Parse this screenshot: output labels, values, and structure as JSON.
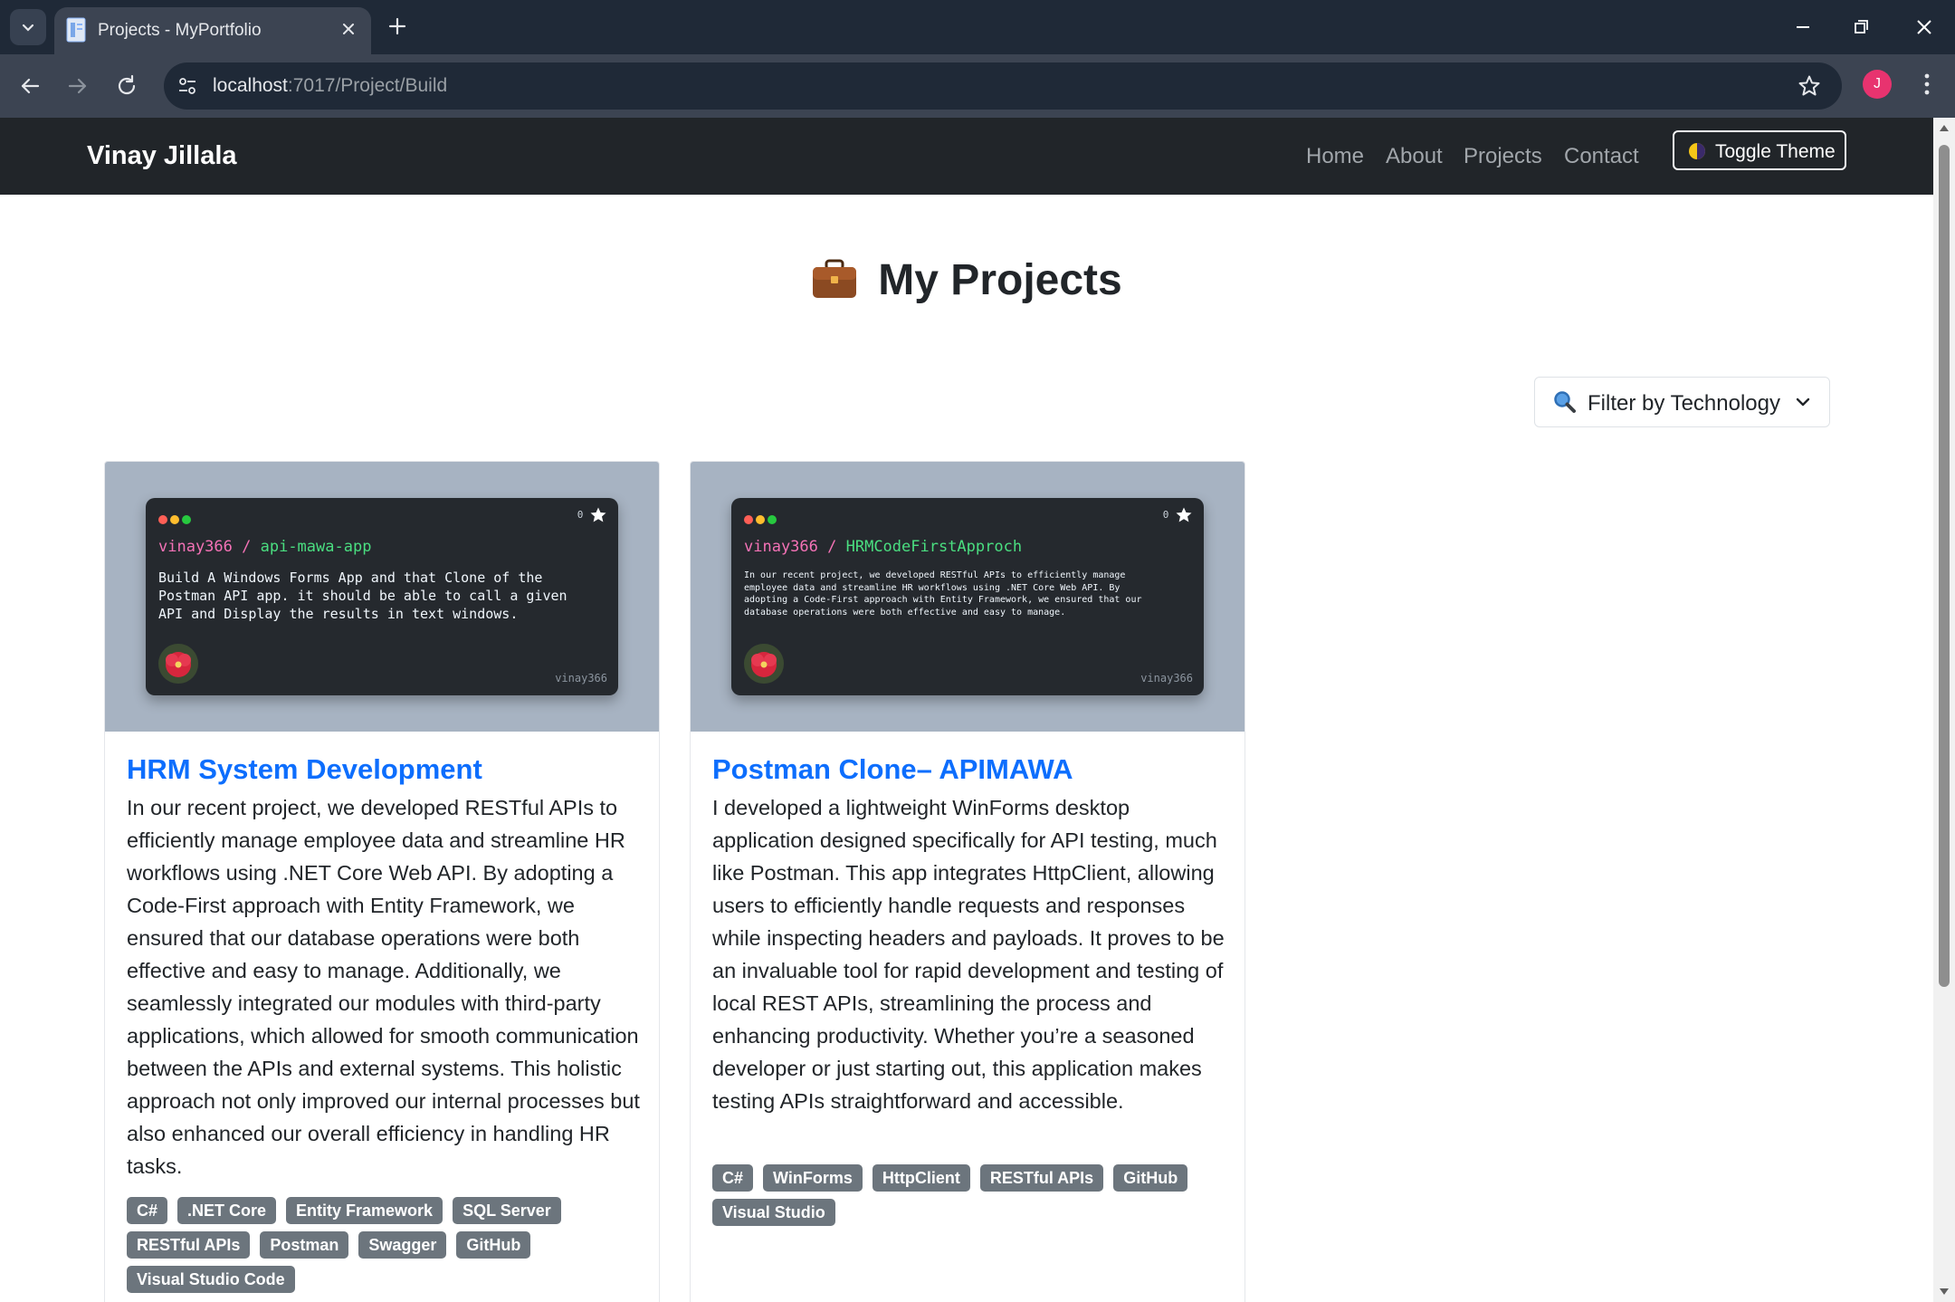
{
  "browser": {
    "tab_title": "Projects - MyPortfolio",
    "url_host": "localhost",
    "url_rest": ":7017/Project/Build",
    "profile_initial": "J"
  },
  "site": {
    "brand": "Vinay Jillala",
    "nav": [
      {
        "label": "Home"
      },
      {
        "label": "About"
      },
      {
        "label": "Projects"
      },
      {
        "label": "Contact"
      }
    ],
    "toggle_theme": "Toggle Theme"
  },
  "page": {
    "heading": "My Projects",
    "filter_label": "Filter by Technology"
  },
  "projects": [
    {
      "title": "HRM System Development",
      "description": "In our recent project, we developed RESTful APIs to efficiently manage employee data and streamline HR workflows using .NET Core Web API. By adopting a Code-First approach with Entity Framework, we ensured that our database operations were both effective and easy to manage. Additionally, we seamlessly integrated our modules with third-party applications, which allowed for smooth communication between the APIs and external systems. This holistic approach not only improved our internal processes but also enhanced our overall efficiency in handling HR tasks.",
      "tags": [
        "C#",
        ".NET Core",
        "Entity Framework",
        "SQL Server",
        "RESTful APIs",
        "Postman",
        "Swagger",
        "GitHub",
        "Visual Studio Code"
      ],
      "repo_card": {
        "owner": "vinay366",
        "repo": "api-mawa-app",
        "stars": "0",
        "description": "Build A Windows Forms App and that Clone of the\nPostman API app. it should be able to call a given\nAPI and Display the results in text windows.",
        "user": "vinay366"
      }
    },
    {
      "title": "Postman Clone– APIMAWA",
      "description": "I developed a lightweight WinForms desktop application designed specifically for API testing, much like Postman. This app integrates HttpClient, allowing users to efficiently handle requests and responses while inspecting headers and payloads. It proves to be an invaluable tool for rapid development and testing of local REST APIs, streamlining the process and enhancing productivity. Whether you’re a seasoned developer or just starting out, this application makes testing APIs straightforward and accessible.",
      "tags": [
        "C#",
        "WinForms",
        "HttpClient",
        "RESTful APIs",
        "GitHub",
        "Visual Studio"
      ],
      "repo_card": {
        "owner": "vinay366",
        "repo": "HRMCodeFirstApproch",
        "stars": "0",
        "description": "In our recent project, we developed RESTful APIs to efficiently manage\nemployee data and streamline HR workflows using .NET Core Web API. By\nadopting a Code-First approach with Entity Framework, we ensured that our\ndatabase operations were both effective and easy to manage.",
        "user": "vinay366"
      }
    }
  ],
  "colors": {
    "navbar_bg": "#212529",
    "link_blue": "#0d6efd",
    "tag_bg": "#6c757d",
    "card_image_bg": "#a7b3c2"
  }
}
